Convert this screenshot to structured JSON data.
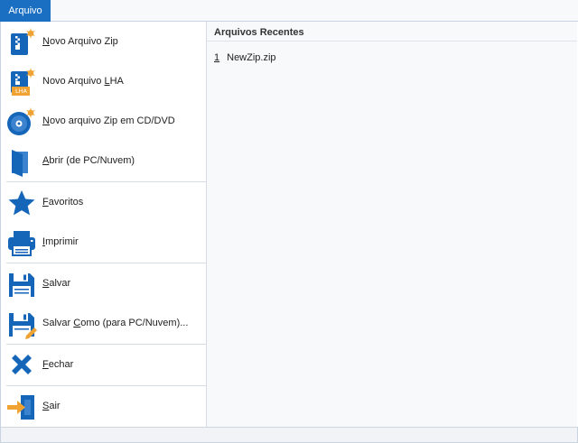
{
  "menu_tab": {
    "label": "Arquivo"
  },
  "menu": {
    "items": [
      {
        "pre": "",
        "key": "N",
        "post": "ovo Arquivo Zip"
      },
      {
        "pre": "Novo Arquivo ",
        "key": "L",
        "post": "HA"
      },
      {
        "pre": "",
        "key": "N",
        "post": "ovo arquivo Zip em CD/DVD"
      },
      {
        "pre": "",
        "key": "A",
        "post": "brir (de PC/Nuvem)"
      },
      {
        "pre": "",
        "key": "F",
        "post": "avoritos"
      },
      {
        "pre": "",
        "key": "I",
        "post": "mprimir"
      },
      {
        "pre": "",
        "key": "S",
        "post": "alvar"
      },
      {
        "pre": "Salvar ",
        "key": "C",
        "post": "omo (para PC/Nuvem)..."
      },
      {
        "pre": "",
        "key": "F",
        "post": "echar"
      },
      {
        "pre": "",
        "key": "S",
        "post": "air"
      }
    ],
    "lha_badge": "LHA"
  },
  "recent": {
    "header": "Arquivos Recentes",
    "files": [
      {
        "num": "1",
        "name": "NewZip.zip"
      }
    ]
  },
  "colors": {
    "accent": "#1a6fc2",
    "icon_blue": "#1565b8",
    "icon_orange": "#f0a232"
  }
}
